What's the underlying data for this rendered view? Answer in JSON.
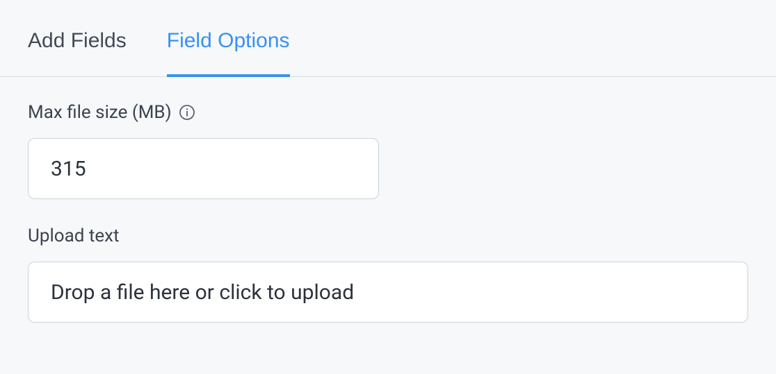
{
  "tabs": {
    "add_fields": "Add Fields",
    "field_options": "Field Options"
  },
  "form": {
    "max_file_size": {
      "label": "Max file size (MB)",
      "value": "315"
    },
    "upload_text": {
      "label": "Upload text",
      "value": "Drop a file here or click to upload"
    }
  }
}
